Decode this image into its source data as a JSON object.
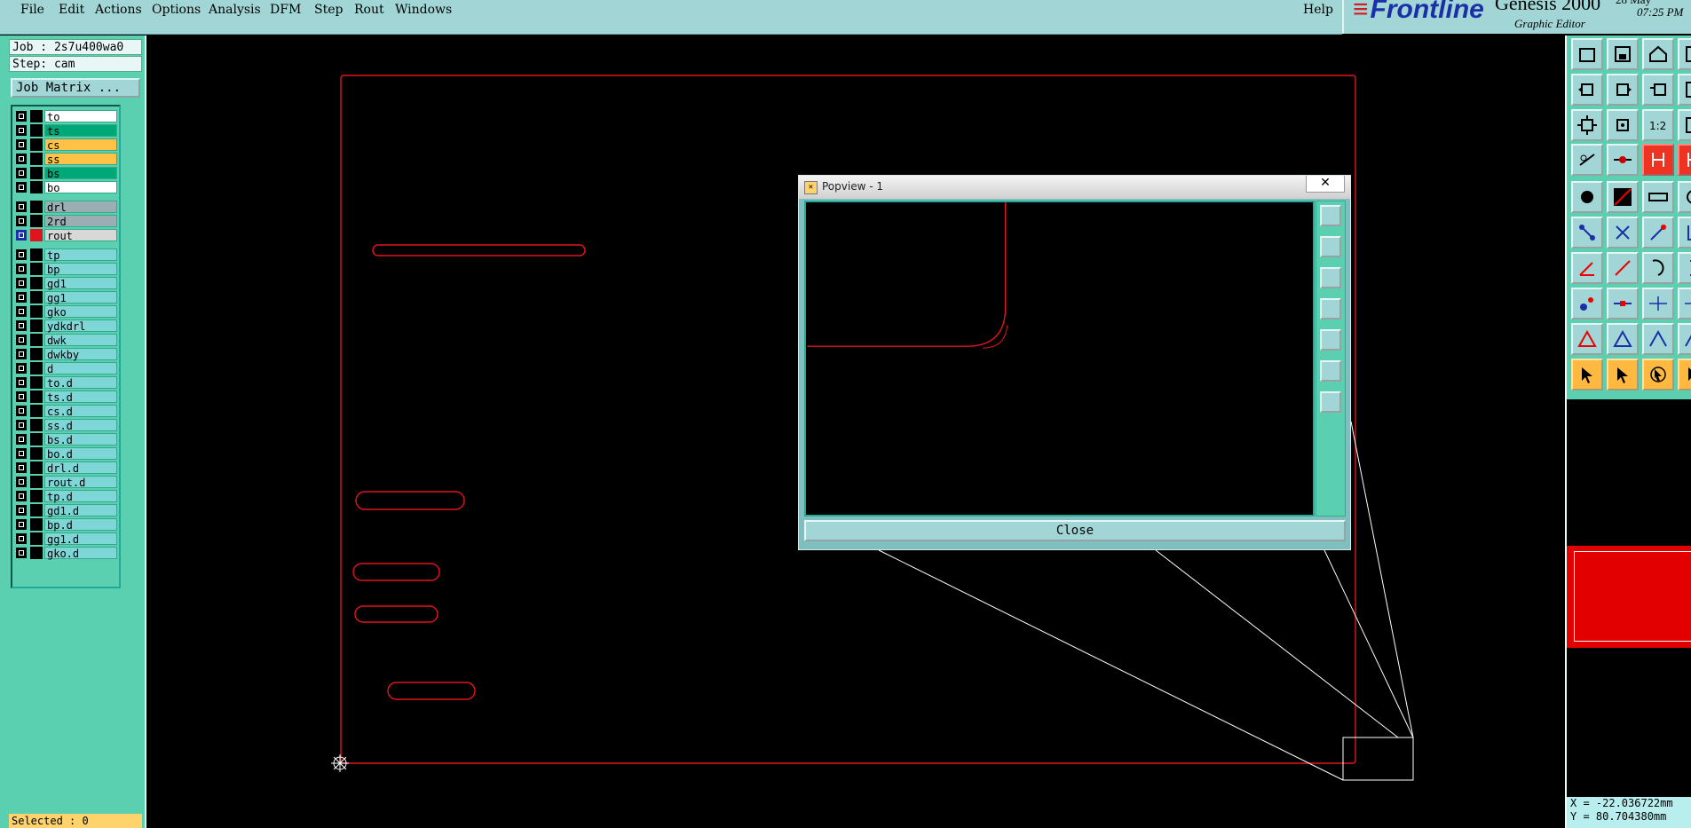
{
  "menubar": {
    "items": [
      "File",
      "Edit",
      "Actions",
      "Options",
      "Analysis",
      "DFM",
      "Step",
      "Rout",
      "Windows"
    ],
    "help": "Help"
  },
  "brand": {
    "logo": "Frontline",
    "product": "Genesis 2000",
    "date_fragment": "28 May",
    "time": "07:25 PM",
    "subtitle": "Graphic Editor"
  },
  "job_info": {
    "job": "Job : 2s7u400wa0",
    "step": "Step: cam",
    "matrix_button": "Job Matrix ..."
  },
  "layers": [
    {
      "name": "to",
      "bg": "#ffffff"
    },
    {
      "name": "ts",
      "bg": "#00a878"
    },
    {
      "name": "cs",
      "bg": "#ffc247"
    },
    {
      "name": "ss",
      "bg": "#ffc247"
    },
    {
      "name": "bs",
      "bg": "#00a878"
    },
    {
      "name": "bo",
      "bg": "#ffffff"
    },
    {
      "name": "drl",
      "bg": "#9aaeb4"
    },
    {
      "name": "2rd",
      "bg": "#9aaeb4"
    },
    {
      "name": "rout",
      "bg": "#d8d8d8",
      "active": true
    },
    {
      "name": "tp",
      "bg": "#7fd6d6"
    },
    {
      "name": "bp",
      "bg": "#7fd6d6"
    },
    {
      "name": "gd1",
      "bg": "#7fd6d6"
    },
    {
      "name": "gg1",
      "bg": "#7fd6d6"
    },
    {
      "name": "gko",
      "bg": "#7fd6d6"
    },
    {
      "name": "ydkdrl",
      "bg": "#7fd6d6"
    },
    {
      "name": "dwk",
      "bg": "#7fd6d6"
    },
    {
      "name": "dwkby",
      "bg": "#7fd6d6"
    },
    {
      "name": "d",
      "bg": "#7fd6d6"
    },
    {
      "name": "to.d",
      "bg": "#7fd6d6"
    },
    {
      "name": "ts.d",
      "bg": "#7fd6d6"
    },
    {
      "name": "cs.d",
      "bg": "#7fd6d6"
    },
    {
      "name": "ss.d",
      "bg": "#7fd6d6"
    },
    {
      "name": "bs.d",
      "bg": "#7fd6d6"
    },
    {
      "name": "bo.d",
      "bg": "#7fd6d6"
    },
    {
      "name": "drl.d",
      "bg": "#7fd6d6"
    },
    {
      "name": "rout.d",
      "bg": "#7fd6d6"
    },
    {
      "name": "tp.d",
      "bg": "#7fd6d6"
    },
    {
      "name": "gd1.d",
      "bg": "#7fd6d6"
    },
    {
      "name": "bp.d",
      "bg": "#7fd6d6"
    },
    {
      "name": "gg1.d",
      "bg": "#7fd6d6"
    },
    {
      "name": "gko.d",
      "bg": "#7fd6d6"
    }
  ],
  "status": {
    "selected": "Selected : 0"
  },
  "popview": {
    "title": "Popview - 1",
    "close_x": "✕",
    "close_button": "Close"
  },
  "coords": {
    "x": "X = -22.036722mm",
    "y": "Y = 80.704380mm"
  },
  "colors": {
    "menu_bg": "#a2d6d6",
    "panel_bg": "#5ad0b0",
    "rout_line": "#e0141e",
    "canvas_bg": "#000000"
  },
  "toolbar_icons": [
    "open-job-icon",
    "save-icon",
    "home-icon",
    "window-icon",
    "pan-left-icon",
    "pan-right-icon",
    "zoom-back-icon",
    "window-2-icon",
    "fit-icon",
    "zoom-home-icon",
    "scale-icon",
    "zoom-icon",
    "measure-icon",
    "snap-icon",
    "layer-connect-icon",
    "layer-connect-2-icon",
    "pad-icon",
    "line-icon",
    "ruler-icon",
    "circle-icon",
    "node-connect-icon",
    "x-node-icon",
    "segment-icon",
    "corner-icon",
    "angle-icon",
    "slope-icon",
    "arc-icon",
    "bracket-icon",
    "move-node-icon",
    "split-icon",
    "dimension-icon",
    "dimension-2-icon",
    "triangle-icon",
    "triangle-2-icon",
    "arch-icon",
    "arch-2-icon",
    "pointer-icon",
    "pointer-2-icon",
    "pointer-3-icon",
    "pointer-4-icon"
  ]
}
